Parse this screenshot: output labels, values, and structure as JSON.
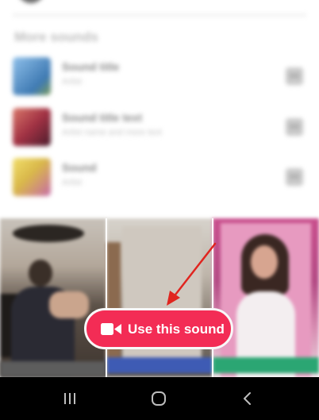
{
  "section_title": "More sounds",
  "sounds": [
    {
      "title": "Sound title",
      "subtitle": "Artist",
      "cover_colors": [
        "#6fa7d8",
        "#3f7ab3"
      ]
    },
    {
      "title": "Sound title text",
      "subtitle": "Artist name and more text",
      "cover_colors": [
        "#c24a4a",
        "#7b2b3a"
      ]
    },
    {
      "title": "Sound",
      "subtitle": "Artist",
      "cover_colors": [
        "#e5c94d",
        "#c66aa8"
      ]
    }
  ],
  "use_sound_button": {
    "label": "Use this sound",
    "icon": "video-camera-icon",
    "color": "#f32c55"
  },
  "nav_bar": {
    "recents_icon": "recents-icon",
    "home_icon": "home-icon",
    "back_icon": "back-icon"
  },
  "annotation": {
    "color": "#e0251f"
  }
}
